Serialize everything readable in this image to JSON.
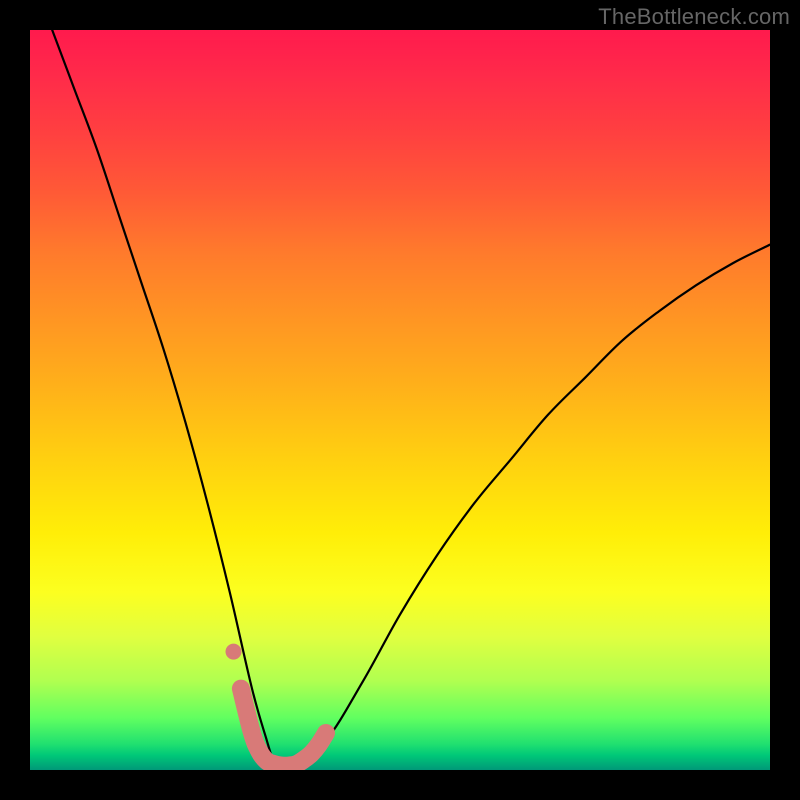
{
  "watermark": "TheBottleneck.com",
  "chart_data": {
    "type": "line",
    "title": "",
    "xlabel": "",
    "ylabel": "",
    "xlim": [
      0,
      100
    ],
    "ylim": [
      0,
      100
    ],
    "grid": false,
    "legend": false,
    "note": "Bottleneck curve plot with rainbow performance gradient background. The black curve depicts bottleneck percentage vs. some component axis, with a sharp valley near x≈33 reaching ~0 (no bottleneck, green zone). A short salmon segment highlights the near-zero valley region.",
    "series": [
      {
        "name": "bottleneck-curve",
        "color": "#000000",
        "x": [
          3,
          6,
          9,
          12,
          15,
          18,
          21,
          24,
          27,
          30,
          32,
          33,
          34,
          36,
          40,
          45,
          50,
          55,
          60,
          65,
          70,
          75,
          80,
          85,
          90,
          95,
          100
        ],
        "y": [
          100,
          92,
          84,
          75,
          66,
          57,
          47,
          36,
          24,
          11,
          4,
          1,
          0.5,
          1,
          4,
          12,
          21,
          29,
          36,
          42,
          48,
          53,
          58,
          62,
          65.5,
          68.5,
          71
        ]
      },
      {
        "name": "highlight-valley",
        "color": "#d87a78",
        "x": [
          28.5,
          30,
          31,
          32,
          33,
          34,
          35,
          36,
          37,
          38,
          39,
          40
        ],
        "y": [
          11,
          5,
          2.5,
          1.2,
          0.8,
          0.6,
          0.6,
          0.8,
          1.4,
          2.2,
          3.4,
          5
        ]
      },
      {
        "name": "highlight-dot",
        "color": "#d87a78",
        "type": "scatter",
        "x": [
          27.5
        ],
        "y": [
          16
        ]
      }
    ],
    "gradient_stops": [
      {
        "pct": 0,
        "color": "#ff1a4d"
      },
      {
        "pct": 6,
        "color": "#ff2a4a"
      },
      {
        "pct": 14,
        "color": "#ff4040"
      },
      {
        "pct": 22,
        "color": "#ff5a36"
      },
      {
        "pct": 30,
        "color": "#ff7a2c"
      },
      {
        "pct": 38,
        "color": "#ff9224"
      },
      {
        "pct": 48,
        "color": "#ffb01a"
      },
      {
        "pct": 58,
        "color": "#ffd010"
      },
      {
        "pct": 68,
        "color": "#ffee08"
      },
      {
        "pct": 76,
        "color": "#fcff20"
      },
      {
        "pct": 82,
        "color": "#e0ff40"
      },
      {
        "pct": 88,
        "color": "#b0ff50"
      },
      {
        "pct": 93,
        "color": "#60ff60"
      },
      {
        "pct": 96.5,
        "color": "#20e070"
      },
      {
        "pct": 98,
        "color": "#00c878"
      },
      {
        "pct": 99,
        "color": "#00b078"
      },
      {
        "pct": 100,
        "color": "#009878"
      }
    ]
  }
}
